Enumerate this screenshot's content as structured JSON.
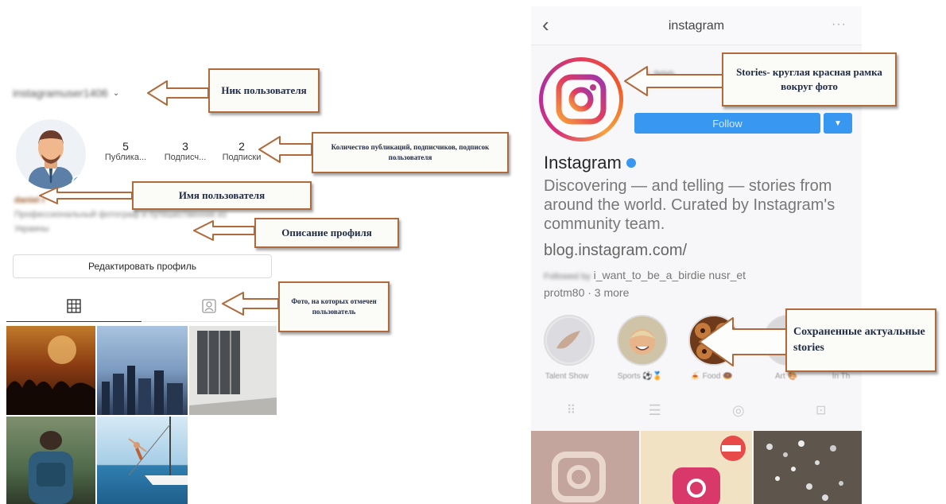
{
  "left": {
    "username": "instagramuser1406",
    "stats": [
      {
        "value": "5",
        "label": "Публика..."
      },
      {
        "value": "3",
        "label": "Подписч..."
      },
      {
        "value": "2",
        "label": "Подписки"
      }
    ],
    "display_name": "daniel r",
    "bio_line1": "Профессиональный фотограф и путешественник из",
    "bio_line2": "Украины",
    "edit_button": "Редактировать профиль"
  },
  "callouts": {
    "nick": "Ник пользователя",
    "counts": "Количество публикаций, подписчиков, подписок пользователя",
    "name": "Имя пользователя",
    "bio": "Описание профиля",
    "tagged": "Фото, на которых отмечен пользователь",
    "stories": "Stories- круглая красная рамка вокруг фото",
    "highlights": "Сохраненные актуальные stories"
  },
  "right": {
    "header_title": "instagram",
    "stat_numbers": "4,300",
    "follow_button": "Follow",
    "profile_name": "Instagram",
    "bio": "Discovering — and telling — stories from around the world. Curated by Instagram's community team.",
    "link": "blog.instagram.com/",
    "followed_by_prefix": "Followed by",
    "followed_by_names": "i_want_to_be_a_birdie  nusr_et",
    "followed_by_more": "protm80 · 3 more",
    "highlights": [
      {
        "label": "Talent Show"
      },
      {
        "label": "Sports ⚽🏅"
      },
      {
        "label": "🍝 Food 🍩"
      },
      {
        "label": "Art 🎨"
      },
      {
        "label": "In Th"
      }
    ]
  },
  "colors": {
    "callout_border": "#b06a3b",
    "follow_blue": "#3897f0",
    "verified": "#3897f0"
  }
}
